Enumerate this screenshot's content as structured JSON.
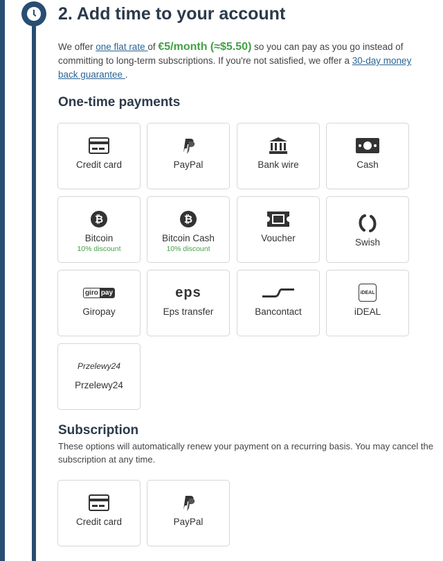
{
  "step": {
    "title": "2. Add time to your account",
    "icon": "clock-icon"
  },
  "intro": {
    "part1": "We offer ",
    "flat_rate_link": "one flat rate ",
    "part2": "of ",
    "price": "€5/month (≈$5.50)",
    "part3": " so you can pay as you go instead of committing to long-term subscriptions. If you're not satisfied, we offer a ",
    "guarantee_link": "30-day money back guarantee ",
    "part4": "."
  },
  "one_time": {
    "heading": "One-time payments",
    "methods": [
      {
        "label": "Credit card",
        "icon": "credit-card-icon"
      },
      {
        "label": "PayPal",
        "icon": "paypal-icon"
      },
      {
        "label": "Bank wire",
        "icon": "bank-icon"
      },
      {
        "label": "Cash",
        "icon": "cash-icon"
      },
      {
        "label": "Bitcoin",
        "icon": "bitcoin-icon",
        "discount": "10% discount"
      },
      {
        "label": "Bitcoin Cash",
        "icon": "bitcoin-cash-icon",
        "discount": "10% discount"
      },
      {
        "label": "Voucher",
        "icon": "voucher-icon"
      },
      {
        "label": "Swish",
        "icon": "swish-icon"
      },
      {
        "label": "Giropay",
        "icon": "giropay-icon",
        "logo_text_1": "giro",
        "logo_text_2": "pay"
      },
      {
        "label": "Eps transfer",
        "icon": "eps-icon",
        "logo_text": "eps"
      },
      {
        "label": "Bancontact",
        "icon": "bancontact-icon"
      },
      {
        "label": "iDEAL",
        "icon": "ideal-icon",
        "logo_text": "iDEAL"
      },
      {
        "label": "Przelewy24",
        "icon": "przelewy24-icon",
        "logo_text": "Przelewy24"
      }
    ]
  },
  "subscription": {
    "heading": "Subscription",
    "description": "These options will automatically renew your payment on a recurring basis. You may cancel the subscription at any time.",
    "methods": [
      {
        "label": "Credit card",
        "icon": "credit-card-icon"
      },
      {
        "label": "PayPal",
        "icon": "paypal-icon"
      }
    ]
  },
  "colors": {
    "accent": "#294d73",
    "price_green": "#43a047",
    "link": "#2a6496"
  }
}
